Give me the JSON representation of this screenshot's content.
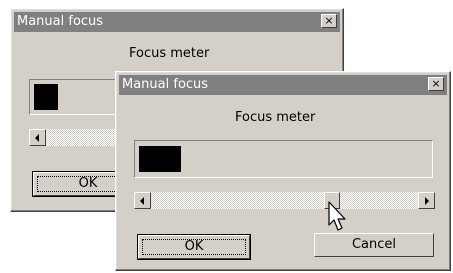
{
  "back_dialog": {
    "title": "Manual focus",
    "close_label": "×",
    "meter_label": "Focus meter",
    "ok_label": "OK"
  },
  "front_dialog": {
    "title": "Manual focus",
    "close_label": "×",
    "meter_label": "Focus meter",
    "ok_label": "OK",
    "cancel_label": "Cancel",
    "slider_value_fraction": 0.69
  },
  "colors": {
    "titlebar_inactive": "#808080",
    "window_face": "#d4d0c8",
    "meter_bar": "#000000"
  },
  "icons": {
    "close": "close-icon",
    "scroll_left": "scroll-left-arrow-icon",
    "scroll_right": "scroll-right-arrow-icon",
    "pointer": "mouse-pointer-icon"
  }
}
